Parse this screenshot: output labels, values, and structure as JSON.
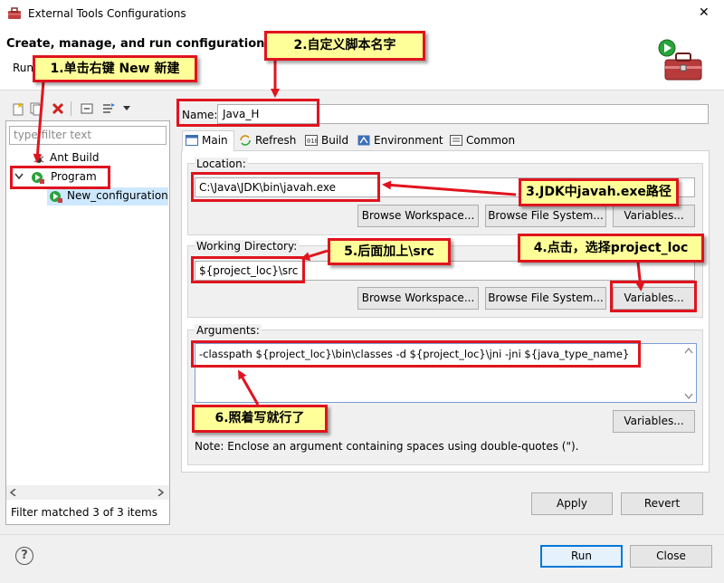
{
  "window": {
    "title": "External Tools Configurations",
    "close_glyph": "✕"
  },
  "header": {
    "title": "Create, manage, and run configurations",
    "subtitle": "Run"
  },
  "sidebar": {
    "filter_placeholder": "type filter text",
    "items": [
      {
        "label": "Ant Build"
      },
      {
        "label": "Program"
      },
      {
        "label": "New_configuration"
      }
    ],
    "status": "Filter matched 3 of 3 items"
  },
  "config": {
    "name_label": "Name:",
    "name_value": "Java_H",
    "tabs": [
      {
        "label": "Main"
      },
      {
        "label": "Refresh"
      },
      {
        "label": "Build"
      },
      {
        "label": "Environment"
      },
      {
        "label": "Common"
      }
    ],
    "location": {
      "label": "Location:",
      "value": "C:\\Java\\JDK\\bin\\javah.exe",
      "buttons": [
        "Browse Workspace...",
        "Browse File System...",
        "Variables..."
      ]
    },
    "working_dir": {
      "label": "Working Directory:",
      "value": "${project_loc}\\src",
      "buttons": [
        "Browse Workspace...",
        "Browse File System...",
        "Variables..."
      ]
    },
    "arguments": {
      "label": "Arguments:",
      "value": "-classpath ${project_loc}\\bin\\classes -d ${project_loc}\\jni -jni ${java_type_name}",
      "variables_button": "Variables...",
      "note": "Note: Enclose an argument containing spaces using double-quotes (\")."
    },
    "apply_button": "Apply",
    "revert_button": "Revert"
  },
  "footer": {
    "help": "?",
    "run_button": "Run",
    "close_button": "Close"
  },
  "annotations": {
    "a1": "1.单击右键 New 新建",
    "a2": "2.自定义脚本名字",
    "a3": "3.JDK中javah.exe路径",
    "a4": "4.点击，选择project_loc",
    "a5": "5.后面加上\\src",
    "a6": "6.照着写就行了"
  },
  "colors": {
    "annotation_red": "#e0141e",
    "callout_yellow": "#ffff99",
    "primary_blue": "#0078d7"
  }
}
